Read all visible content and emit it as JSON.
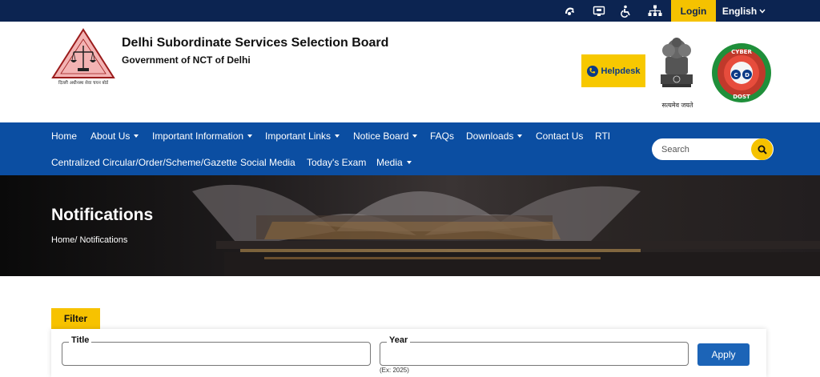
{
  "topbar": {
    "icons": [
      "screen-reader-icon",
      "sitemap-monitor-icon",
      "accessibility-icon",
      "sitemap-icon"
    ],
    "login_label": "Login",
    "language_label": "English"
  },
  "header": {
    "org_title": "Delhi Subordinate Services Selection Board",
    "org_subtitle": "Government of NCT of Delhi",
    "logo_caption": "दिल्ली अधीनस्थ सेवा चयन बोर्ड",
    "helpdesk_label": "Helpdesk",
    "emblem_caption": "सत्यमेव जयते",
    "cyber_top": "CYBER",
    "cyber_bottom": "DOST"
  },
  "nav": {
    "row1": [
      {
        "label": "Home",
        "dropdown": false
      },
      {
        "label": "About Us",
        "dropdown": true
      },
      {
        "label": "Important Information",
        "dropdown": true
      },
      {
        "label": "Important Links",
        "dropdown": true
      },
      {
        "label": "Notice Board",
        "dropdown": true
      },
      {
        "label": "FAQs",
        "dropdown": false
      },
      {
        "label": "Downloads",
        "dropdown": true
      },
      {
        "label": "Contact Us",
        "dropdown": false
      },
      {
        "label": "RTI",
        "dropdown": false
      }
    ],
    "row2": [
      {
        "label": "Centralized Circular/Order/Scheme/Gazette",
        "dropdown": false
      },
      {
        "label": "Social Media",
        "dropdown": false
      },
      {
        "label": "Today's Exam",
        "dropdown": false
      },
      {
        "label": "Media",
        "dropdown": true
      }
    ],
    "search_placeholder": "Search"
  },
  "banner": {
    "title": "Notifications",
    "breadcrumb": "Home/ Notifications"
  },
  "filter": {
    "tab_label": "Filter",
    "title_label": "Title",
    "title_value": "",
    "year_label": "Year",
    "year_value": "",
    "year_hint": "(Ex: 2025)",
    "apply_label": "Apply"
  },
  "colors": {
    "topbar": "#0c2451",
    "nav": "#0b4ea2",
    "accent_yellow": "#f5c200",
    "apply_blue": "#1c64b7"
  }
}
